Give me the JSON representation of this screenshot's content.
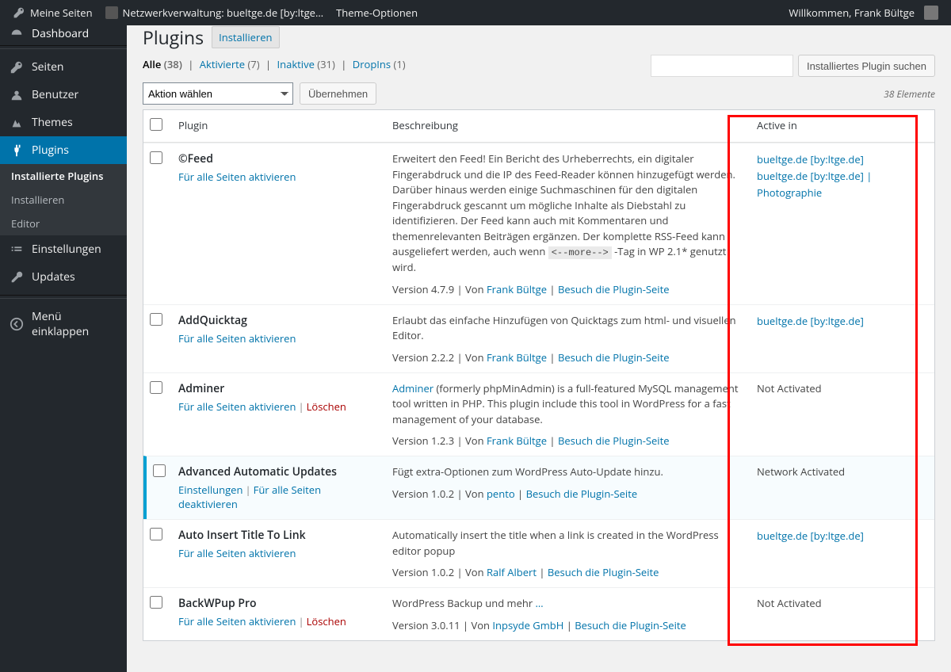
{
  "adminbar": {
    "my_sites": "Meine Seiten",
    "network_admin": "Netzwerkverwaltung: bueltge.de [by:ltge…",
    "theme_options": "Theme-Optionen",
    "welcome": "Willkommen, Frank Bültge"
  },
  "sidebar": {
    "dashboard": "Dashboard",
    "seiten": "Seiten",
    "benutzer": "Benutzer",
    "themes": "Themes",
    "plugins": "Plugins",
    "submenu": {
      "installed": "Installierte Plugins",
      "install": "Installieren",
      "editor": "Editor"
    },
    "einstellungen": "Einstellungen",
    "updates": "Updates",
    "collapse": "Menü einklappen"
  },
  "page": {
    "title": "Plugins",
    "add_new": "Installieren",
    "filters": {
      "all_label": "Alle",
      "all_count": "(38)",
      "active_label": "Aktivierte",
      "active_count": "(7)",
      "inactive_label": "Inaktive",
      "inactive_count": "(31)",
      "dropins_label": "DropIns",
      "dropins_count": "(1)"
    },
    "search_button": "Installiertes Plugin suchen",
    "bulk_placeholder": "Aktion wählen",
    "apply": "Übernehmen",
    "elements": "38 Elemente"
  },
  "table": {
    "head": {
      "plugin": "Plugin",
      "desc": "Beschreibung",
      "active": "Active in"
    }
  },
  "rows": [
    {
      "name": "©Feed",
      "actions": [
        {
          "label": "Für alle Seiten aktivieren",
          "cls": ""
        }
      ],
      "desc_html": "Erweitert den Feed! Ein Bericht des Urheberrechts, ein digitaler Fingerabdruck und die IP des Feed-Reader können hinzugefügt werden. Darüber hinaus werden einige Suchmaschinen für den digitalen Fingerabdruck gescannt um mögliche Inhalte als Diebstahl zu identifizieren. Der Feed kann auch mit Kommentaren und themenrelevanten Beiträgen ergänzen. Der komplette RSS-Feed kann ausgeliefert werden, auch wenn ",
      "desc_code": "<--more-->",
      "desc_tail": " -Tag in WP 2.1* genutzt wird.",
      "meta_version": "Version 4.7.9 | Von ",
      "meta_author": "Frank Bültge",
      "meta_visit": "Besuch die Plugin-Seite",
      "active": [
        {
          "label": "bueltge.de [by:ltge.de]",
          "link": true
        },
        {
          "label": "bueltge.de [by:ltge.de] | Photographie",
          "link": true
        }
      ],
      "is_active": false
    },
    {
      "name": "AddQuicktag",
      "actions": [
        {
          "label": "Für alle Seiten aktivieren",
          "cls": ""
        }
      ],
      "desc_html": "Erlaubt das einfache Hinzufügen von Quicktags zum html- und visuellen Editor.",
      "meta_version": "Version 2.2.2 | Von ",
      "meta_author": "Frank Bültge",
      "meta_visit": "Besuch die Plugin-Seite",
      "active": [
        {
          "label": "bueltge.de [by:ltge.de]",
          "link": true
        }
      ],
      "is_active": false
    },
    {
      "name": "Adminer",
      "actions": [
        {
          "label": "Für alle Seiten aktivieren",
          "cls": ""
        },
        {
          "label": "Löschen",
          "cls": "del"
        }
      ],
      "desc_link_lead": "Adminer",
      "desc_html": " (formerly phpMinAdmin) is a full-featured MySQL management tool written in PHP. This plugin include this tool in WordPress for a fast management of your database.",
      "meta_version": "Version 1.2.3 | Von ",
      "meta_author": "Frank Bültge",
      "meta_visit": "Besuch die Plugin-Seite",
      "active": [
        {
          "label": "Not Activated",
          "link": false
        }
      ],
      "is_active": false
    },
    {
      "name": "Advanced Automatic Updates",
      "actions": [
        {
          "label": "Einstellungen",
          "cls": ""
        },
        {
          "label": "Für alle Seiten deaktivieren",
          "cls": ""
        }
      ],
      "desc_html": "Fügt extra-Optionen zum WordPress Auto-Update hinzu.",
      "meta_version": "Version 1.0.2 | Von ",
      "meta_author": "pento",
      "meta_visit": "Besuch die Plugin-Seite",
      "active": [
        {
          "label": "Network Activated",
          "link": false
        }
      ],
      "is_active": true
    },
    {
      "name": "Auto Insert Title To Link",
      "actions": [
        {
          "label": "Für alle Seiten aktivieren",
          "cls": ""
        }
      ],
      "desc_html": "Automatically insert the title when a link is created in the WordPress editor popup",
      "meta_version": "Version 1.0.2 | Von ",
      "meta_author": "Ralf Albert",
      "meta_visit": "Besuch die Plugin-Seite",
      "active": [
        {
          "label": "bueltge.de [by:ltge.de]",
          "link": true
        }
      ],
      "is_active": false
    },
    {
      "name": "BackWPup Pro",
      "actions": [
        {
          "label": "Für alle Seiten aktivieren",
          "cls": ""
        },
        {
          "label": "Löschen",
          "cls": "del"
        }
      ],
      "desc_html": "WordPress Backup und mehr ",
      "desc_trail_link": "…",
      "meta_version": "Version 3.0.11 | Von ",
      "meta_author": "Inpsyde GmbH",
      "meta_visit": "Besuch die Plugin-Seite",
      "active": [
        {
          "label": "Not Activated",
          "link": false
        }
      ],
      "is_active": false
    }
  ]
}
